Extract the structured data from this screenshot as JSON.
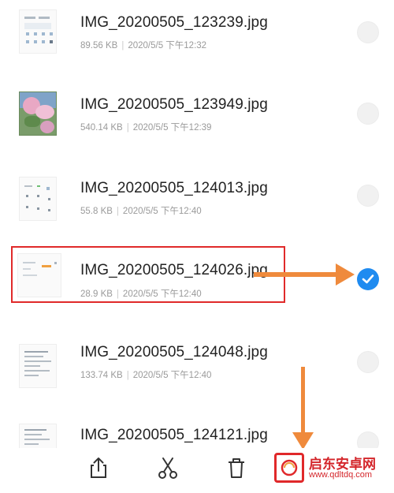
{
  "files": [
    {
      "name": "IMG_20200505_123239.jpg",
      "size": "89.56 KB",
      "date": "2020/5/5 下午12:32",
      "selected": false,
      "thumb": "screenshot-grid"
    },
    {
      "name": "IMG_20200505_123949.jpg",
      "size": "540.14 KB",
      "date": "2020/5/5 下午12:39",
      "selected": false,
      "thumb": "photo"
    },
    {
      "name": "IMG_20200505_124013.jpg",
      "size": "55.8 KB",
      "date": "2020/5/5 下午12:40",
      "selected": false,
      "thumb": "screenshot-sparse"
    },
    {
      "name": "IMG_20200505_124026.jpg",
      "size": "28.9 KB",
      "date": "2020/5/5 下午12:40",
      "selected": true,
      "thumb": "screenshot-orange"
    },
    {
      "name": "IMG_20200505_124048.jpg",
      "size": "133.74 KB",
      "date": "2020/5/5 下午12:40",
      "selected": false,
      "thumb": "document"
    },
    {
      "name": "IMG_20200505_124121.jpg",
      "size": "",
      "date": "",
      "selected": false,
      "thumb": "document"
    }
  ],
  "toolbar": {
    "share_icon": "share-icon",
    "cut_icon": "scissors-icon",
    "delete_icon": "trash-icon"
  },
  "watermark": {
    "line1": "启东安卓网",
    "line2": "www.qdltdq.com"
  },
  "colors": {
    "accent": "#1f8bf0",
    "annotation_box": "#e02a2a",
    "annotation_arrow": "#ef8a3c"
  }
}
